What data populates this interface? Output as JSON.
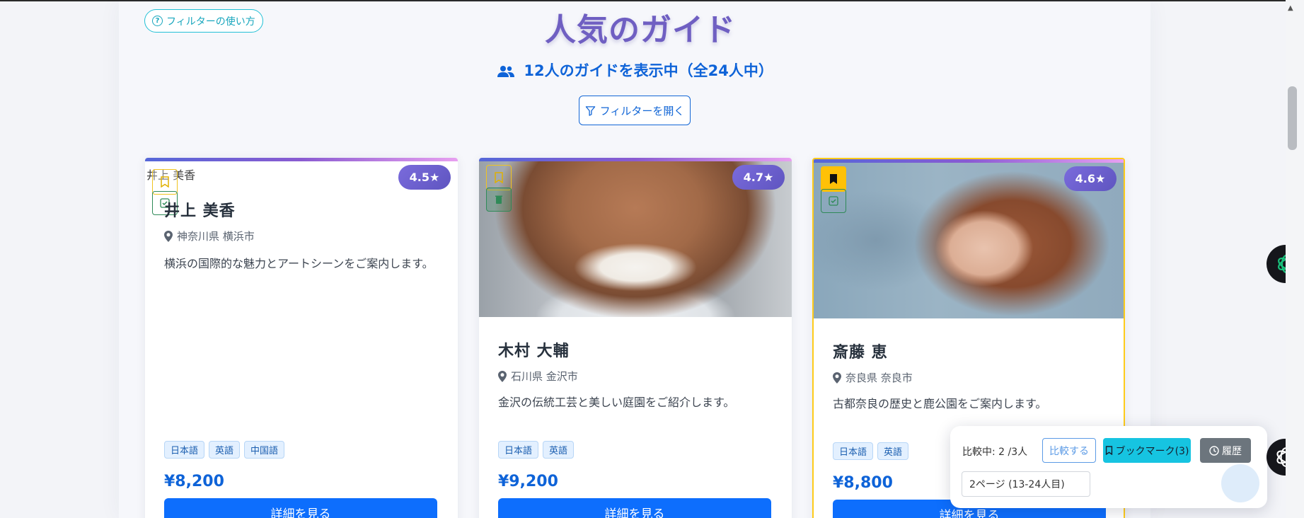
{
  "header": {
    "help_label": "フィルターの使い方",
    "title": "人気のガイド",
    "count_text": "12人のガイドを表示中（全24人中）",
    "filter_button": "フィルターを開く"
  },
  "cards": [
    {
      "photo_alt": "井上 美香",
      "rating": "4.5★",
      "name": "井上 美香",
      "location": "神奈川県 横浜市",
      "description": "横浜の国際的な魅力とアートシーンをご案内します。",
      "languages": [
        "日本語",
        "英語",
        "中国語"
      ],
      "price": "¥8,200",
      "detail_button": "詳細を見る",
      "bookmarked": false
    },
    {
      "rating": "4.7★",
      "name": "木村 大輔",
      "location": "石川県 金沢市",
      "description": "金沢の伝統工芸と美しい庭園をご紹介します。",
      "languages": [
        "日本語",
        "英語"
      ],
      "price": "¥9,200",
      "detail_button": "詳細を見る",
      "bookmarked": false
    },
    {
      "rating": "4.6★",
      "name": "斎藤 恵",
      "location": "奈良県 奈良市",
      "description": "古都奈良の歴史と鹿公園をご案内します。",
      "languages": [
        "日本語",
        "英語"
      ],
      "price": "¥8,800",
      "detail_button": "詳細を見る",
      "bookmarked": true
    }
  ],
  "float_bar": {
    "compare_status": "比較中: 2 /3人",
    "compare_button": "比較する",
    "bookmark_button": "ブックマーク(3)",
    "history_button": "履歴",
    "page_indicator": "2ページ (13-24人目)"
  },
  "colors": {
    "primary": "#0d6efd",
    "title": "#6f5fc2",
    "bookmark_yellow": "#ffc107",
    "info": "#16c4e1"
  }
}
